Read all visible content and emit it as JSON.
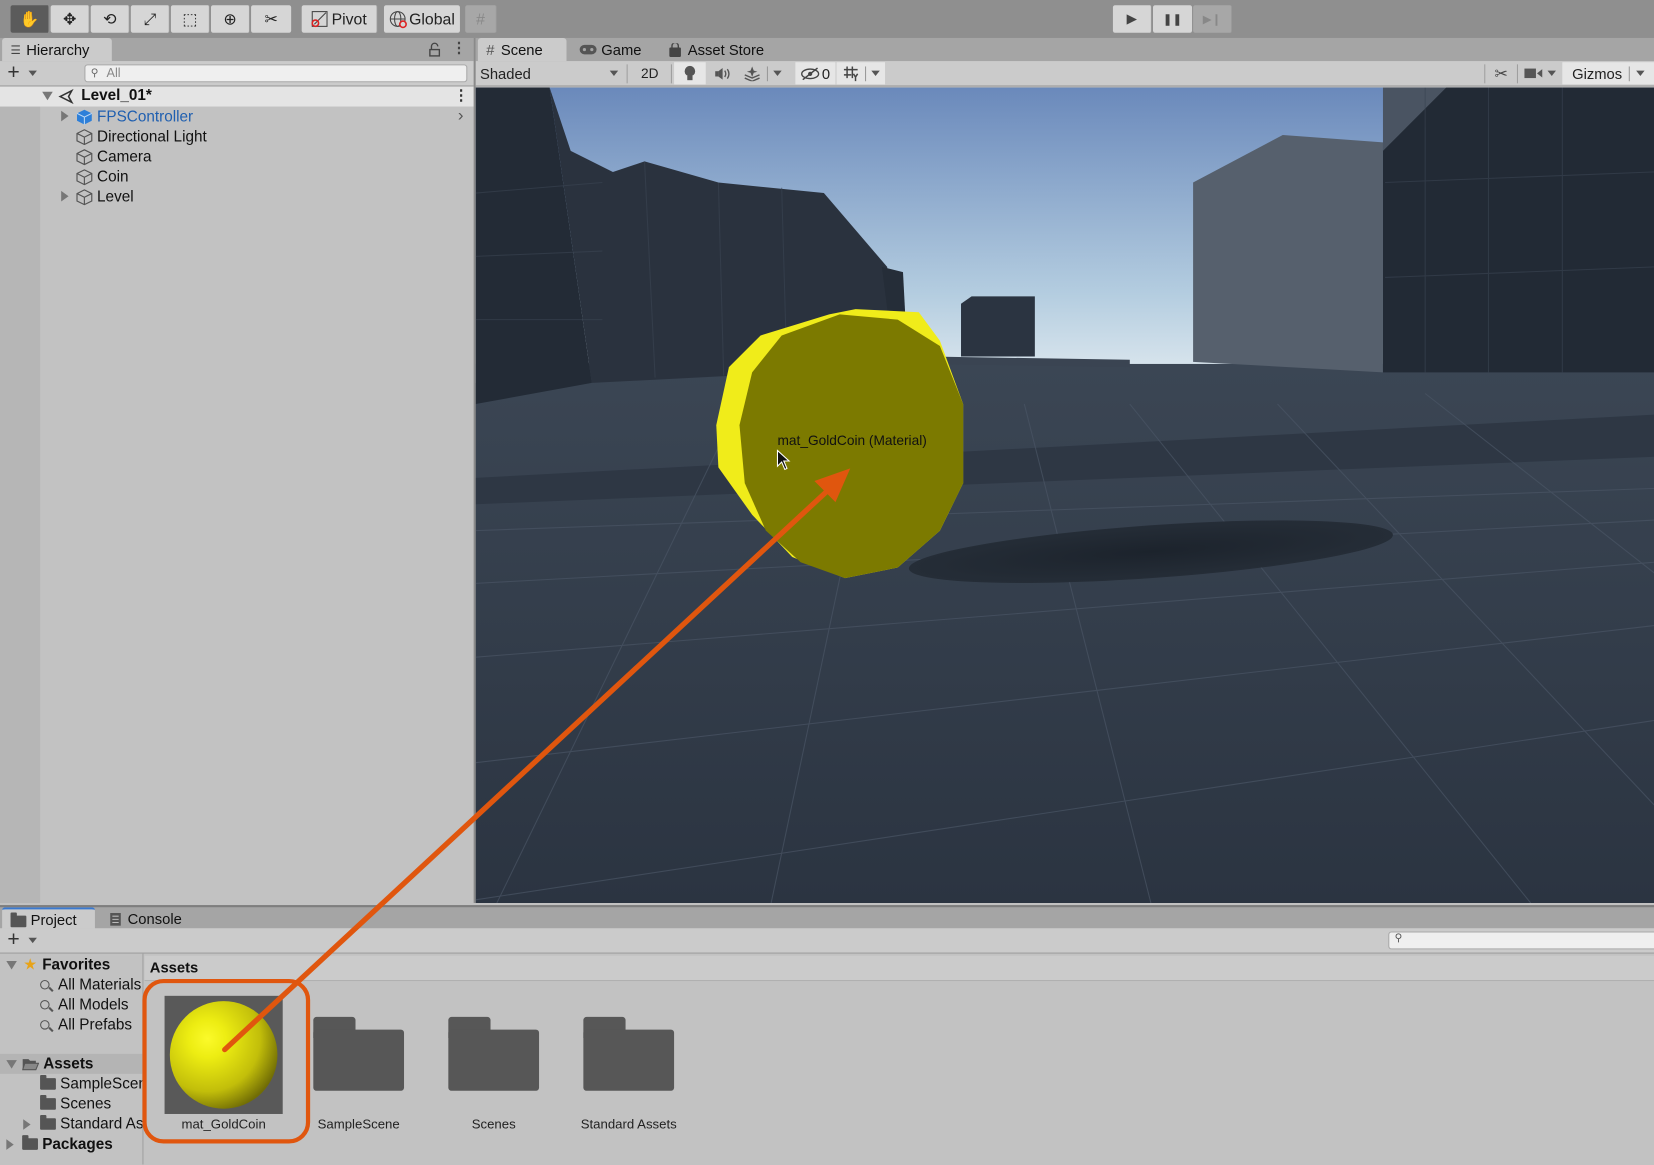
{
  "toolbar": {
    "tools": [
      {
        "name": "hand-tool",
        "glyph": "✋",
        "active": true
      },
      {
        "name": "move-tool",
        "glyph": "✥"
      },
      {
        "name": "rotate-tool",
        "glyph": "⟲"
      },
      {
        "name": "scale-tool",
        "glyph": "⤢"
      },
      {
        "name": "rect-tool",
        "glyph": "⬚"
      },
      {
        "name": "transform-tool",
        "glyph": "⊕"
      },
      {
        "name": "custom-tool",
        "glyph": "✂"
      }
    ],
    "pivot_label": "Pivot",
    "global_label": "Global",
    "snap_glyph": "#",
    "play_glyph": "▶",
    "pause_glyph": "❚❚",
    "step_glyph": "▶❙"
  },
  "hierarchy": {
    "tab_label": "Hierarchy",
    "tab_icon": "☰",
    "add_glyph": "+",
    "search_placeholder": "All",
    "lock_glyph": "🔓",
    "menu_glyph": "⋮",
    "scene_name": "Level_01*",
    "items": [
      {
        "label": "FPSController",
        "expandable": true,
        "prefab": true
      },
      {
        "label": "Directional Light",
        "expandable": false
      },
      {
        "label": "Camera",
        "expandable": false
      },
      {
        "label": "Coin",
        "expandable": false
      },
      {
        "label": "Level",
        "expandable": true
      }
    ],
    "child_arrow": "›"
  },
  "scene": {
    "tabs": [
      {
        "label": "Scene",
        "icon": "#",
        "active": true
      },
      {
        "label": "Game",
        "icon": "🎮"
      },
      {
        "label": "Asset Store",
        "icon": "🛍"
      }
    ],
    "shading_mode": "Shaded",
    "btn_2d": "2D",
    "hidden_count": "0",
    "gizmos_label": "Gizmos",
    "drop_tooltip": "mat_GoldCoin (Material)",
    "colors": {
      "sky_top": "#6f8fc0",
      "sky_bottom": "#c8dae8",
      "ground": "#2f3a48",
      "coin_face": "#7d7a00",
      "coin_edge": "#f2ef1c",
      "annotation": "#e0560e"
    }
  },
  "project": {
    "tabs": [
      {
        "label": "Project",
        "icon": "folder",
        "active": true
      },
      {
        "label": "Console",
        "icon": "console"
      }
    ],
    "add_glyph": "+",
    "favorites_label": "Favorites",
    "favorites": [
      "All Materials",
      "All Models",
      "All Prefabs"
    ],
    "assets_label": "Assets",
    "asset_folders": [
      "SampleScene",
      "Scenes",
      "Standard Assets"
    ],
    "packages_label": "Packages",
    "breadcrumb": "Assets",
    "grid_items": [
      {
        "label": "mat_GoldCoin",
        "type": "material",
        "highlighted": true
      },
      {
        "label": "SampleScene",
        "type": "folder"
      },
      {
        "label": "Scenes",
        "type": "folder"
      },
      {
        "label": "Standard Assets",
        "type": "folder"
      }
    ]
  }
}
